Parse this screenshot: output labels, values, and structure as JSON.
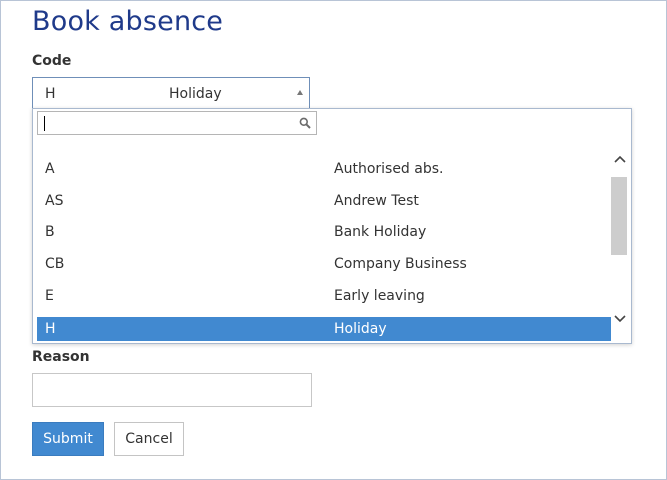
{
  "page": {
    "title": "Book absence"
  },
  "code_field": {
    "label": "Code",
    "selected_code": "H",
    "selected_description": "Holiday",
    "search_value": "",
    "options": [
      {
        "code": "A",
        "description": "Authorised abs."
      },
      {
        "code": "AS",
        "description": "Andrew Test"
      },
      {
        "code": "B",
        "description": "Bank Holiday"
      },
      {
        "code": "CB",
        "description": "Company Business"
      },
      {
        "code": "E",
        "description": "Early leaving"
      },
      {
        "code": "H",
        "description": "Holiday"
      }
    ],
    "selected_index": 5
  },
  "reason_field": {
    "label": "Reason",
    "value": ""
  },
  "buttons": {
    "submit": "Submit",
    "cancel": "Cancel"
  },
  "icons": {
    "search": "search-icon",
    "dropdown_arrow": "caret-up-icon",
    "scroll_up": "chevron-up-icon",
    "scroll_down": "chevron-down-icon"
  },
  "colors": {
    "title": "#1f3a8a",
    "accent": "#4189d0"
  }
}
